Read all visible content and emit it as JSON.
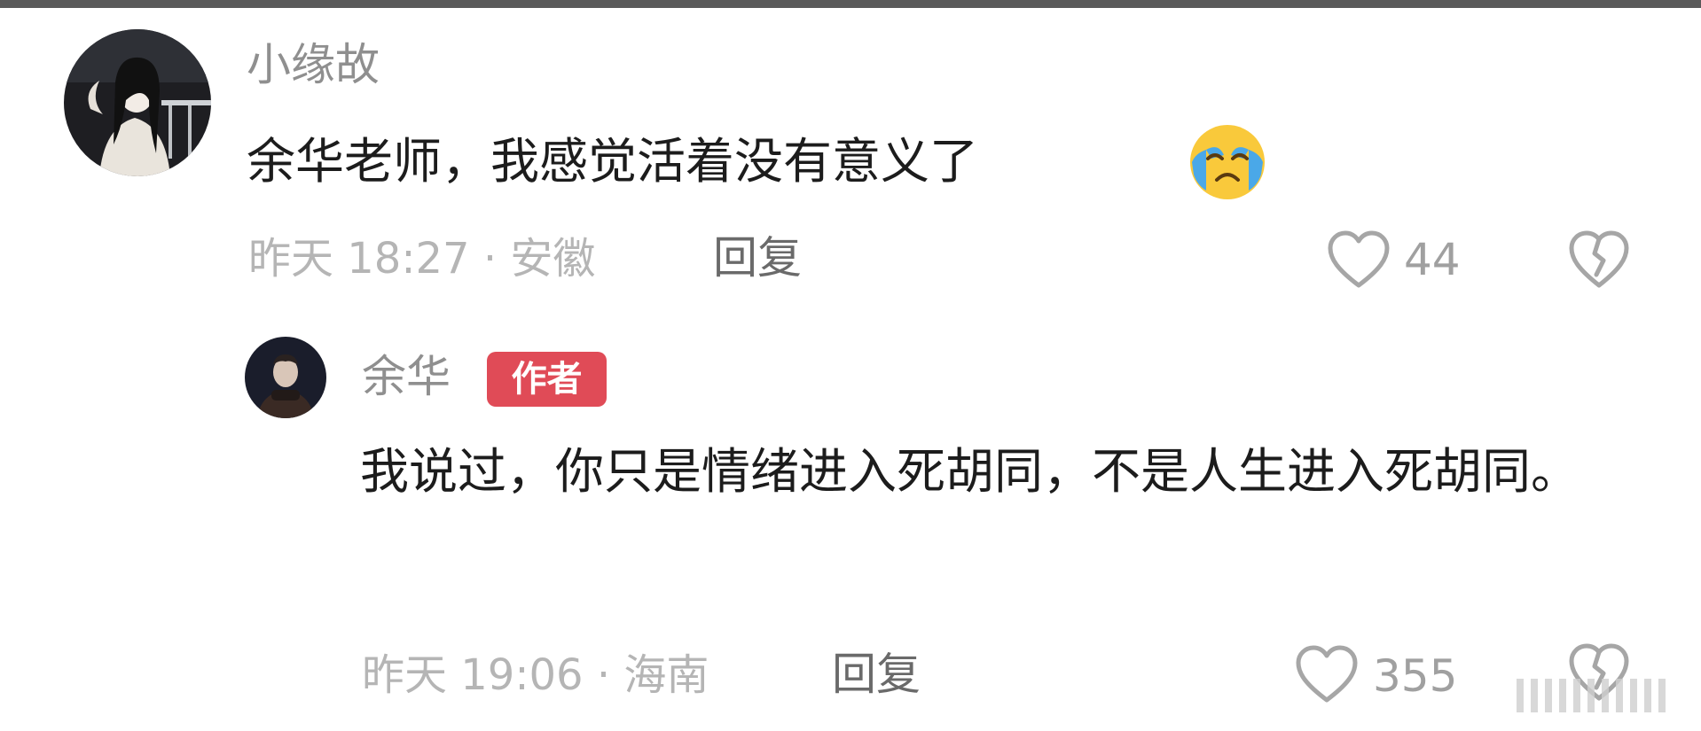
{
  "comments": [
    {
      "username": "小缘故",
      "text": "余华老师，我感觉活着没有意义了",
      "emoji": "crying-face-icon",
      "time": "昨天 18:27",
      "location": "安徽",
      "meta": "昨天 18:27 · 安徽",
      "reply_label": "回复",
      "like_count": "44"
    },
    {
      "username": "余华",
      "badge": "作者",
      "text": "我说过，你只是情绪进入死胡同，不是人生进入死胡同。",
      "time": "昨天 19:06",
      "location": "海南",
      "meta": "昨天 19:06 · 海南",
      "reply_label": "回复",
      "like_count": "355"
    }
  ],
  "colors": {
    "badge": "#e04b57",
    "comment_text": "#1c1c1c",
    "meta_text": "#b5b5b5",
    "username_text": "#8f8f8f"
  }
}
